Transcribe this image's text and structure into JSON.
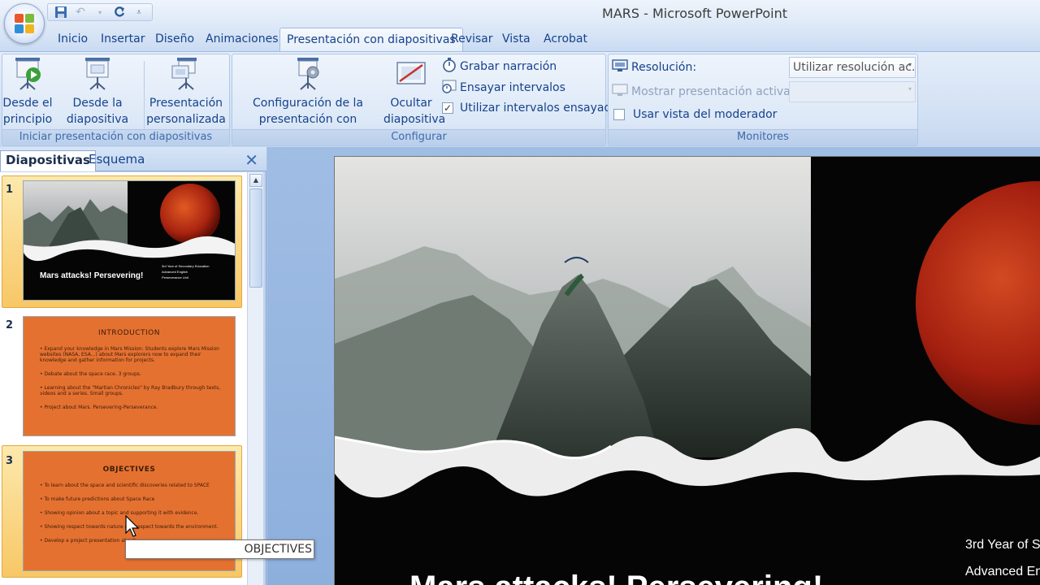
{
  "window": {
    "title": "MARS - Microsoft PowerPoint"
  },
  "quick_access": {
    "icons": [
      "save-icon",
      "undo-icon",
      "redo-icon",
      "customize-icon"
    ]
  },
  "tabs": [
    "Inicio",
    "Insertar",
    "Diseño",
    "Animaciones",
    "Presentación con diapositivas",
    "Revisar",
    "Vista",
    "Acrobat"
  ],
  "active_tab": "Presentación con diapositivas",
  "ribbon": {
    "start_group": {
      "label": "Iniciar presentación con diapositivas",
      "from_beginning": [
        "Desde el",
        "principio"
      ],
      "from_current": [
        "Desde la",
        "diapositiva actual"
      ],
      "custom": [
        "Presentación",
        "personalizada"
      ]
    },
    "setup_group": {
      "label": "Configurar",
      "setup_show": [
        "Configuración de la",
        "presentación con diapositivas"
      ],
      "hide_slide": [
        "Ocultar",
        "diapositiva"
      ],
      "record_narration": "Grabar narración",
      "rehearse_timings": "Ensayar intervalos",
      "use_timings": "Utilizar intervalos ensayados",
      "use_timings_checked": true
    },
    "monitors_group": {
      "label": "Monitores",
      "resolution_label": "Resolución:",
      "resolution_value": "Utilizar resolución ac...",
      "show_on_label": "Mostrar presentación activada:",
      "show_on_value": "",
      "presenter_view": "Usar vista del moderador",
      "presenter_view_checked": false
    }
  },
  "left_pane": {
    "tabs": [
      "Diapositivas",
      "Esquema"
    ],
    "active_tab": "Diapositivas",
    "slides": [
      {
        "number": "1",
        "title": "Mars attacks! Persevering!",
        "meta": [
          "3rd Year of Secondary Education",
          "Advanced English",
          "Perseverance Unit"
        ]
      },
      {
        "number": "2",
        "heading": "INTRODUCTION",
        "bullets": [
          "Expand your knowledge in Mars Mission: Students explore Mars Mission websites (NASA, ESA...) about Mars explorers now to expand their knowledge and gather information for projects.",
          "Debate about the space race. 3 groups.",
          "Learning about the \"Martian Chronicles\" by Ray Bradbury through texts, videos and a series. Small groups.",
          "Project about Mars. Persevering-Perseverance."
        ]
      },
      {
        "number": "3",
        "heading": "OBJECTIVES",
        "bullets": [
          "To learn about the space and scientific discoveries related to SPACE",
          "To make future predictions about Space Race",
          "Showing opinion about a topic and supporting it with evidence.",
          "Showing respect towards nature and respect towards the environment.",
          "Develop a project presentation about..."
        ]
      }
    ]
  },
  "tooltip": "OBJECTIVES",
  "main_slide": {
    "title": "Mars attacks! Persevering!",
    "meta_line1": "3rd Year of S",
    "meta_line2": "Advanced En"
  },
  "colors": {
    "slide_orange": "#e57131",
    "mars_red": "#b52412",
    "ribbon_text": "#15428b"
  }
}
